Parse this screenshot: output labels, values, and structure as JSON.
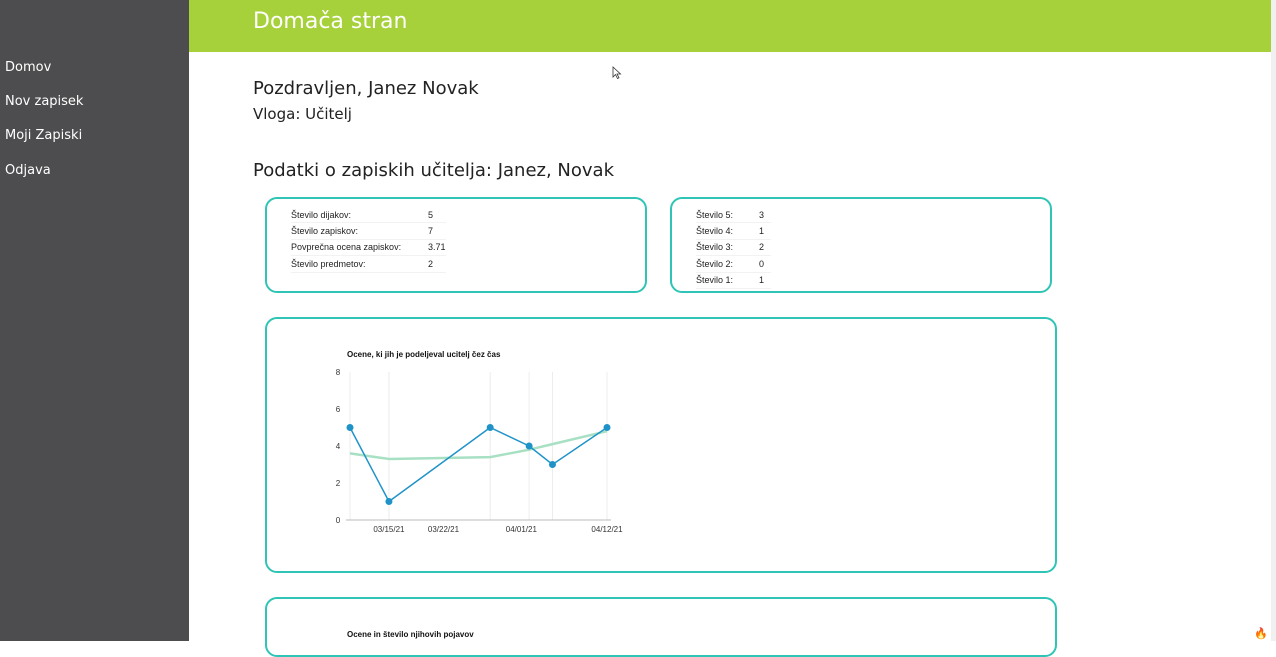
{
  "sidebar": {
    "items": [
      {
        "label": "Domov"
      },
      {
        "label": "Nov zapisek"
      },
      {
        "label": "Moji Zapiski"
      },
      {
        "label": "Odjava"
      }
    ]
  },
  "header": {
    "title": "Domača stran"
  },
  "main": {
    "greeting": "Pozdravljen, Janez Novak",
    "role": "Vloga: Učitelj",
    "section_title": "Podatki o zapiskih učitelja: Janez, Novak"
  },
  "summary_stats": [
    {
      "label": "Število dijakov:",
      "value": "5"
    },
    {
      "label": "Število zapiskov:",
      "value": "7"
    },
    {
      "label": "Povprečna ocena zapiskov:",
      "value": "3.71"
    },
    {
      "label": "Število predmetov:",
      "value": "2"
    }
  ],
  "grade_counts": [
    {
      "label": "Število 5:",
      "value": "3"
    },
    {
      "label": "Število 4:",
      "value": "1"
    },
    {
      "label": "Število 3:",
      "value": "2"
    },
    {
      "label": "Število 2:",
      "value": "0"
    },
    {
      "label": "Število 1:",
      "value": "1"
    }
  ],
  "colors": {
    "sidebar_bg": "#4d4d4f",
    "header_bg": "#a6d13a",
    "card_border": "#2ec4b6",
    "series_line": "#1f93c8",
    "trend_line": "#a8e0c4"
  },
  "chart_data": [
    {
      "type": "line",
      "title": "Ocene, ki jih je podeljeval ucitelj čez čas",
      "x_ticks": [
        "03/15/21",
        "03/22/21",
        "04/01/21",
        "04/12/21"
      ],
      "x": [
        "03/10/21",
        "03/15/21",
        "03/28/21",
        "04/02/21",
        "04/05/21",
        "04/12/21"
      ],
      "series": [
        {
          "values": [
            5,
            1,
            5,
            4,
            3,
            5
          ]
        }
      ],
      "trend": {
        "type": "quadratic",
        "values": [
          3.6,
          3.3,
          3.4,
          3.8,
          4.1,
          4.8
        ]
      },
      "y_ticks": [
        0,
        2,
        4,
        6,
        8
      ],
      "ylim": [
        0,
        8
      ],
      "grid": "vertical"
    },
    {
      "title": "Ocene in število njihovih pojavov"
    }
  ]
}
